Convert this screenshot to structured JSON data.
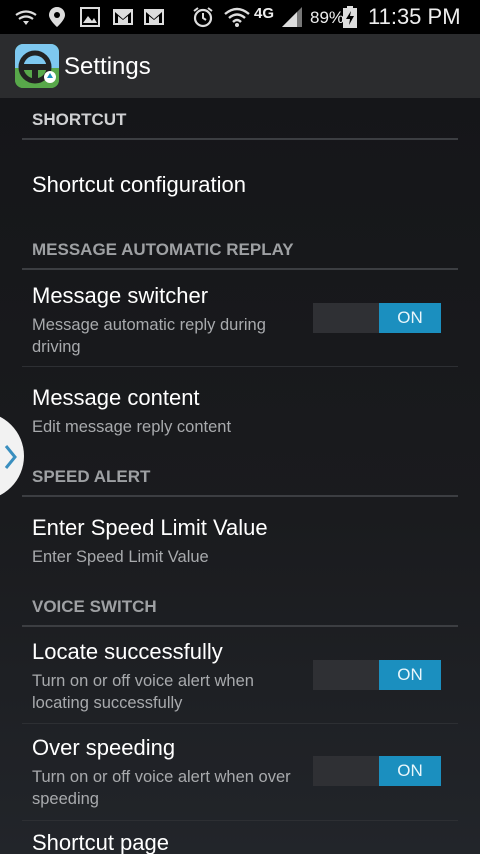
{
  "status_bar": {
    "icons": [
      "signal-sync-icon",
      "location-pin-icon",
      "image-icon",
      "gmail-icon",
      "gmail-icon",
      "alarm-icon",
      "wifi-icon",
      "lte-icon",
      "cell-signal-icon",
      "battery-charging-icon"
    ],
    "network": "4G",
    "battery": "89%",
    "time": "11:35 PM"
  },
  "app_bar": {
    "title": "Settings",
    "icon": "steering-wheel-app-icon"
  },
  "sections": {
    "shortcut": "SHORTCUT",
    "message_reply": "MESSAGE AUTOMATIC REPLAY",
    "speed_alert": "SPEED ALERT",
    "voice_switch": "VOICE SWITCH"
  },
  "items": {
    "shortcut_config": {
      "title": "Shortcut configuration"
    },
    "message_switcher": {
      "title": "Message switcher",
      "summary": "Message automatic reply during driving",
      "toggle": "ON"
    },
    "message_content": {
      "title": "Message content",
      "summary": "Edit message reply content"
    },
    "speed_limit": {
      "title": "Enter Speed Limit Value",
      "summary": "Enter Speed Limit Value"
    },
    "locate_success": {
      "title": "Locate successfully",
      "summary": "Turn on or off voice alert when locating successfully",
      "toggle": "ON"
    },
    "over_speeding": {
      "title": "Over speeding",
      "summary": "Turn on or off voice alert when over speeding",
      "toggle": "ON"
    },
    "shortcut_page": {
      "title": "Shortcut page"
    }
  },
  "colors": {
    "accent": "#1b8fbf",
    "app_bar": "#2b2c2e",
    "section_header": "#9ea0a3"
  }
}
